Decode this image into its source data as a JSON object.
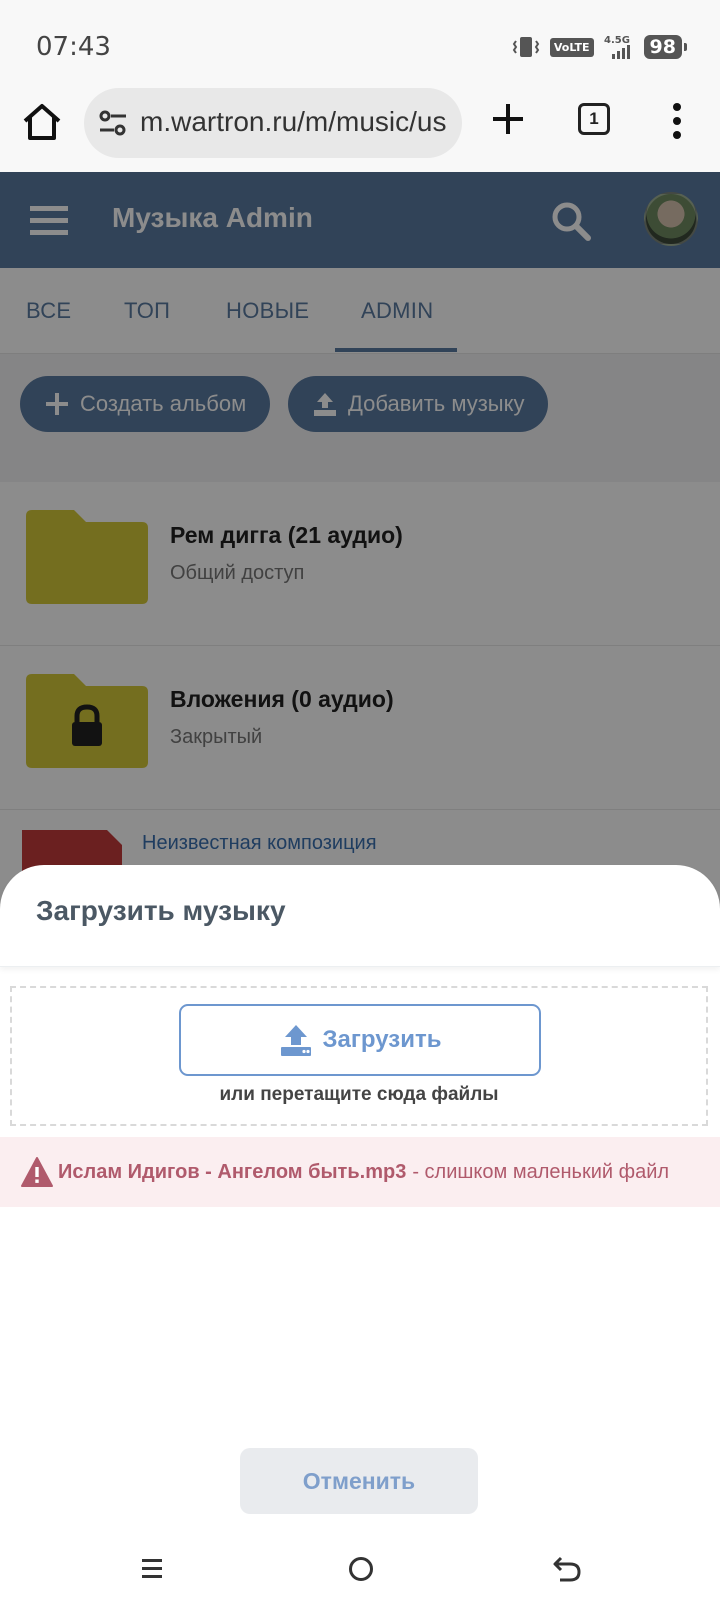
{
  "status_bar": {
    "time": "07:43",
    "volte": "VoLTE",
    "network": "4.5G",
    "battery": "98",
    "icons": [
      "vibrate-icon",
      "signal-icon",
      "battery-icon"
    ]
  },
  "browser": {
    "url": "m.wartron.ru/m/music/us",
    "tab_count": "1",
    "icons": [
      "home-icon",
      "site-settings-icon",
      "plus-icon",
      "tabs-icon",
      "more-vert-icon"
    ]
  },
  "app": {
    "title": "Музыка Admin",
    "header_color": "#5a7aa0"
  },
  "tabs": [
    {
      "label": "ВСЕ"
    },
    {
      "label": "ТОП"
    },
    {
      "label": "НОВЫЕ"
    },
    {
      "label": "ADMIN",
      "active": true
    }
  ],
  "actions": {
    "create_album": "Создать альбом",
    "add_music": "Добавить музыку"
  },
  "albums": [
    {
      "title": "Рем дигга (21 аудио)",
      "subtitle": "Общий доступ",
      "locked": false
    },
    {
      "title": "Вложения (0 аудио)",
      "subtitle": "Закрытый",
      "locked": true
    }
  ],
  "track": {
    "title": "Неизвестная композиция"
  },
  "upload_sheet": {
    "title": "Загрузить музыку",
    "upload_button": "Загрузить",
    "drop_hint": "или перетащите сюда файлы",
    "error_file": "Ислам Идигов - Ангелом быть.mp3",
    "error_message": "- слишком маленький файл",
    "cancel": "Отменить"
  },
  "colors": {
    "accent": "#6d97cf",
    "error_text": "#b05a6c",
    "error_bg": "#fbeef0",
    "folder": "#d4c83a"
  }
}
